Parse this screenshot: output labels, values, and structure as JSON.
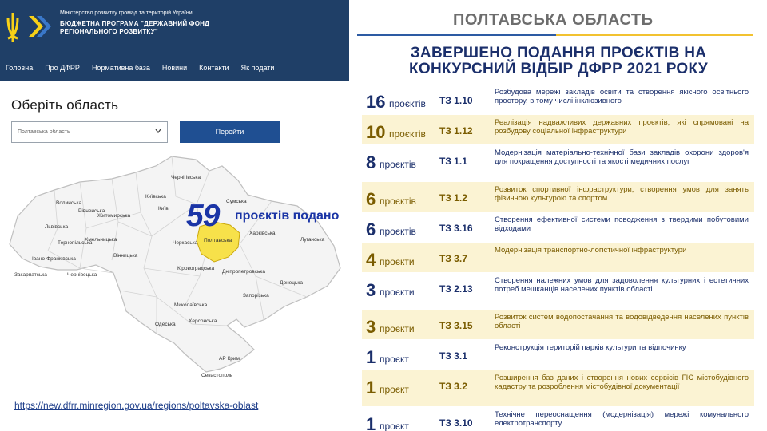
{
  "site": {
    "org_line": "Міністерство розвитку громад та територій України",
    "program_title": "Бюджетна програма \"Державний фонд регіонального розвитку\"",
    "nav": [
      "Головна",
      "Про ДФРР",
      "Нормативна база",
      "Новини",
      "Контакти",
      "Як подати"
    ],
    "select_heading": "Оберіть область",
    "select_value": "Полтавська область",
    "go_button": "Перейти",
    "link": "https://new.dfrr.minregion.gov.ua/regions/poltavska-oblast"
  },
  "map": {
    "highlight_color": "#f7e14a",
    "regions": [
      "Чернігівська",
      "Волинська",
      "Рівненська",
      "Житомирська",
      "Київ",
      "Київська",
      "Сумська",
      "Львівська",
      "Хмельницька",
      "Тернопільська",
      "Вінницька",
      "Черкаська",
      "Полтавська",
      "Харківська",
      "Луганська",
      "Івано-Франківська",
      "Закарпатська",
      "Чернівецька",
      "Кіровоградська",
      "Дніпропетровська",
      "Донецька",
      "Запорізька",
      "Миколаївська",
      "Одеська",
      "Херсонська",
      "АР Крим",
      "Севастополь"
    ],
    "count": "59",
    "count_label": "проєктів подано"
  },
  "info": {
    "region": "ПОЛТАВСЬКА ОБЛАСТЬ",
    "title": "ЗАВЕРШЕНО ПОДАННЯ ПРОЄКТІВ НА КОНКУРСНИЙ ВІДБІР ДФРР 2021 РОКУ",
    "rows": [
      {
        "count": "16",
        "unit": "проєктів",
        "code": "ТЗ  1.10",
        "desc": "Розбудова мережі закладів освіти та створення якісного освітнього простору, в тому числі інклюзивного"
      },
      {
        "count": "10",
        "unit": "проєктів",
        "code": "ТЗ  1.12",
        "desc": "Реалізація надважливих державних проєктів, які спрямовані на розбудову соціальної інфраструктури"
      },
      {
        "count": "8",
        "unit": "проєктів",
        "code": "ТЗ  1.1",
        "desc": "Модернізація матеріально-технічної бази закладів охорони здоров'я для покращення доступності та якості медичних послуг"
      },
      {
        "count": "6",
        "unit": "проєктів",
        "code": "ТЗ  1.2",
        "desc": "Розвиток спортивної інфраструктури, створення умов для занять фізичною культурою та спортом"
      },
      {
        "count": "6",
        "unit": "проєктів",
        "code": "ТЗ  3.16",
        "desc": "Створення ефективної системи поводження з твердими побутовими відходами"
      },
      {
        "count": "4",
        "unit": "проєкти",
        "code": "ТЗ  3.7",
        "desc": "Модернізація транспортно-логістичної інфраструктури"
      },
      {
        "count": "3",
        "unit": "проєкти",
        "code": "ТЗ  2.13",
        "desc": "Створення належних умов для задоволення культурних і естетичних потреб мешканців населених пунктів області"
      },
      {
        "count": "3",
        "unit": "проєкти",
        "code": "ТЗ  3.15",
        "desc": "Розвиток систем водопостачання та водовідведення населених пунктів області"
      },
      {
        "count": "1",
        "unit": "проєкт",
        "code": "ТЗ  3.1",
        "desc": "Реконструкція територій парків культури та відпочинку"
      },
      {
        "count": "1",
        "unit": "проєкт",
        "code": "ТЗ  3.2",
        "desc": "Розширення баз даних і створення нових сервісів ГІС містобудівного кадастру та розроблення містобудівної документації"
      },
      {
        "count": "1",
        "unit": "проєкт",
        "code": "ТЗ  3.10",
        "desc": "Технічне переоснащення (модернізація) мережі комунального електротранспорту"
      }
    ]
  }
}
